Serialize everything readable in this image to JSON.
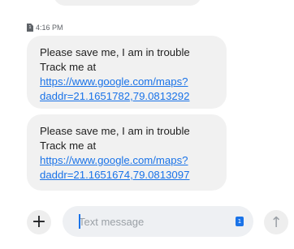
{
  "conversation": {
    "timestamp": "4:16 PM",
    "sim_number": "1",
    "messages": [
      {
        "line1": "Please save me, I am in trouble",
        "prefix": "Track me at ",
        "link": "https://www.google.com/maps?daddr=21.1651782,79.0813292"
      },
      {
        "line1": "Please save me, I am in trouble",
        "prefix": "Track me at ",
        "link": "https://www.google.com/maps?daddr=21.1651674,79.0813097"
      }
    ]
  },
  "compose": {
    "placeholder": "Text message",
    "value": "",
    "sim_badge": "1"
  },
  "icons": {
    "add": "plus-icon",
    "send": "arrow-up-icon",
    "sim": "sim-card-icon"
  },
  "colors": {
    "link": "#1a73e8",
    "bubble": "#f1f1f1",
    "accent": "#1a73e8"
  }
}
